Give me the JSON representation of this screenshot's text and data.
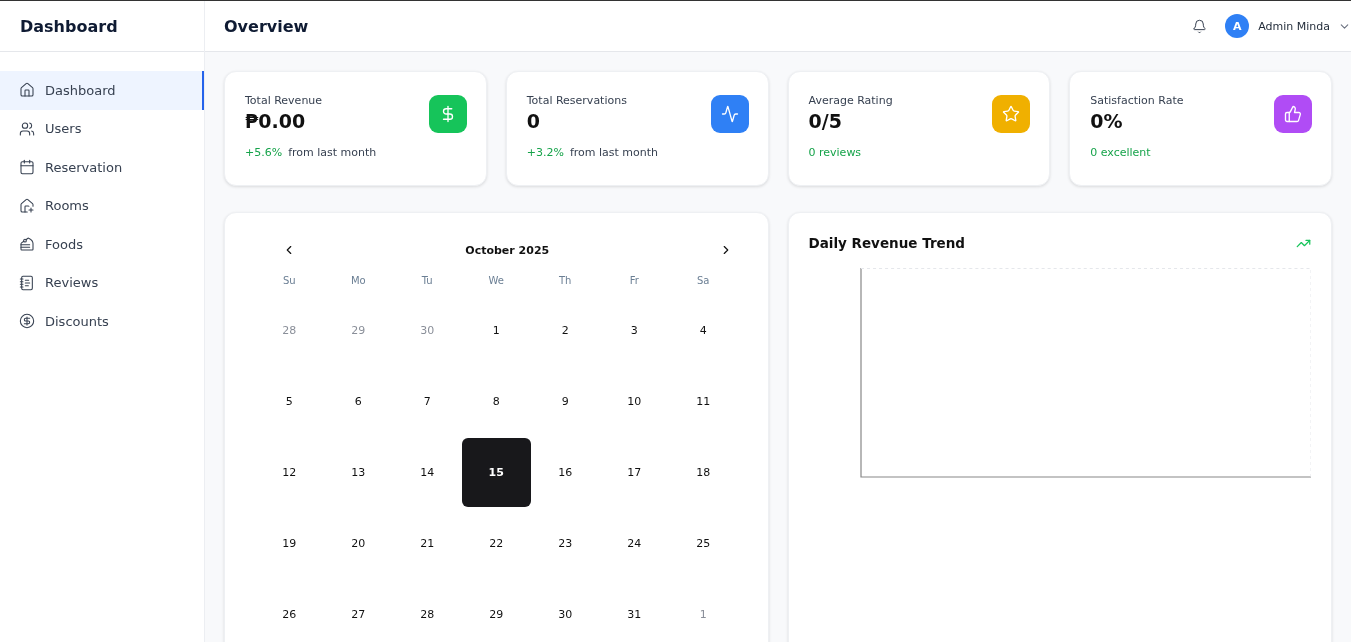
{
  "sidebar": {
    "title": "Dashboard",
    "items": [
      {
        "label": "Dashboard",
        "selected": true
      },
      {
        "label": "Users",
        "selected": false
      },
      {
        "label": "Reservation",
        "selected": false
      },
      {
        "label": "Rooms",
        "selected": false
      },
      {
        "label": "Foods",
        "selected": false
      },
      {
        "label": "Reviews",
        "selected": false
      },
      {
        "label": "Discounts",
        "selected": false
      }
    ]
  },
  "header": {
    "title": "Overview",
    "user": {
      "initial": "A",
      "name": "Admin Minda"
    }
  },
  "stats": [
    {
      "label": "Total Revenue",
      "value": "₱0.00",
      "change": "+5.6%",
      "note": "from last month",
      "color": "#16c45a"
    },
    {
      "label": "Total Reservations",
      "value": "0",
      "change": "+3.2%",
      "note": "from last month",
      "color": "#2f80f5"
    },
    {
      "label": "Average Rating",
      "value": "0/5",
      "change": "0 reviews",
      "color": "#f0b000"
    },
    {
      "label": "Satisfaction Rate",
      "value": "0%",
      "change": "0 excellent",
      "color": "#b04cf5"
    }
  ],
  "calendar": {
    "month": "October 2025",
    "weekdays": [
      "Su",
      "Mo",
      "Tu",
      "We",
      "Th",
      "Fr",
      "Sa"
    ],
    "weeks": [
      [
        {
          "day": "28",
          "outside": true,
          "selected": false
        },
        {
          "day": "29",
          "outside": true,
          "selected": false
        },
        {
          "day": "30",
          "outside": true,
          "selected": false
        },
        {
          "day": "1",
          "outside": false,
          "selected": false
        },
        {
          "day": "2",
          "outside": false,
          "selected": false
        },
        {
          "day": "3",
          "outside": false,
          "selected": false
        },
        {
          "day": "4",
          "outside": false,
          "selected": false
        }
      ],
      [
        {
          "day": "5",
          "outside": false,
          "selected": false
        },
        {
          "day": "6",
          "outside": false,
          "selected": false
        },
        {
          "day": "7",
          "outside": false,
          "selected": false
        },
        {
          "day": "8",
          "outside": false,
          "selected": false
        },
        {
          "day": "9",
          "outside": false,
          "selected": false
        },
        {
          "day": "10",
          "outside": false,
          "selected": false
        },
        {
          "day": "11",
          "outside": false,
          "selected": false
        }
      ],
      [
        {
          "day": "12",
          "outside": false,
          "selected": false
        },
        {
          "day": "13",
          "outside": false,
          "selected": false
        },
        {
          "day": "14",
          "outside": false,
          "selected": false
        },
        {
          "day": "15",
          "outside": false,
          "selected": true
        },
        {
          "day": "16",
          "outside": false,
          "selected": false
        },
        {
          "day": "17",
          "outside": false,
          "selected": false
        },
        {
          "day": "18",
          "outside": false,
          "selected": false
        }
      ],
      [
        {
          "day": "19",
          "outside": false,
          "selected": false
        },
        {
          "day": "20",
          "outside": false,
          "selected": false
        },
        {
          "day": "21",
          "outside": false,
          "selected": false
        },
        {
          "day": "22",
          "outside": false,
          "selected": false
        },
        {
          "day": "23",
          "outside": false,
          "selected": false
        },
        {
          "day": "24",
          "outside": false,
          "selected": false
        },
        {
          "day": "25",
          "outside": false,
          "selected": false
        }
      ],
      [
        {
          "day": "26",
          "outside": false,
          "selected": false
        },
        {
          "day": "27",
          "outside": false,
          "selected": false
        },
        {
          "day": "28",
          "outside": false,
          "selected": false
        },
        {
          "day": "29",
          "outside": false,
          "selected": false
        },
        {
          "day": "30",
          "outside": false,
          "selected": false
        },
        {
          "day": "31",
          "outside": false,
          "selected": false
        },
        {
          "day": "1",
          "outside": true,
          "selected": false
        }
      ]
    ]
  },
  "revenue_chart": {
    "title": "Daily Revenue Trend"
  }
}
